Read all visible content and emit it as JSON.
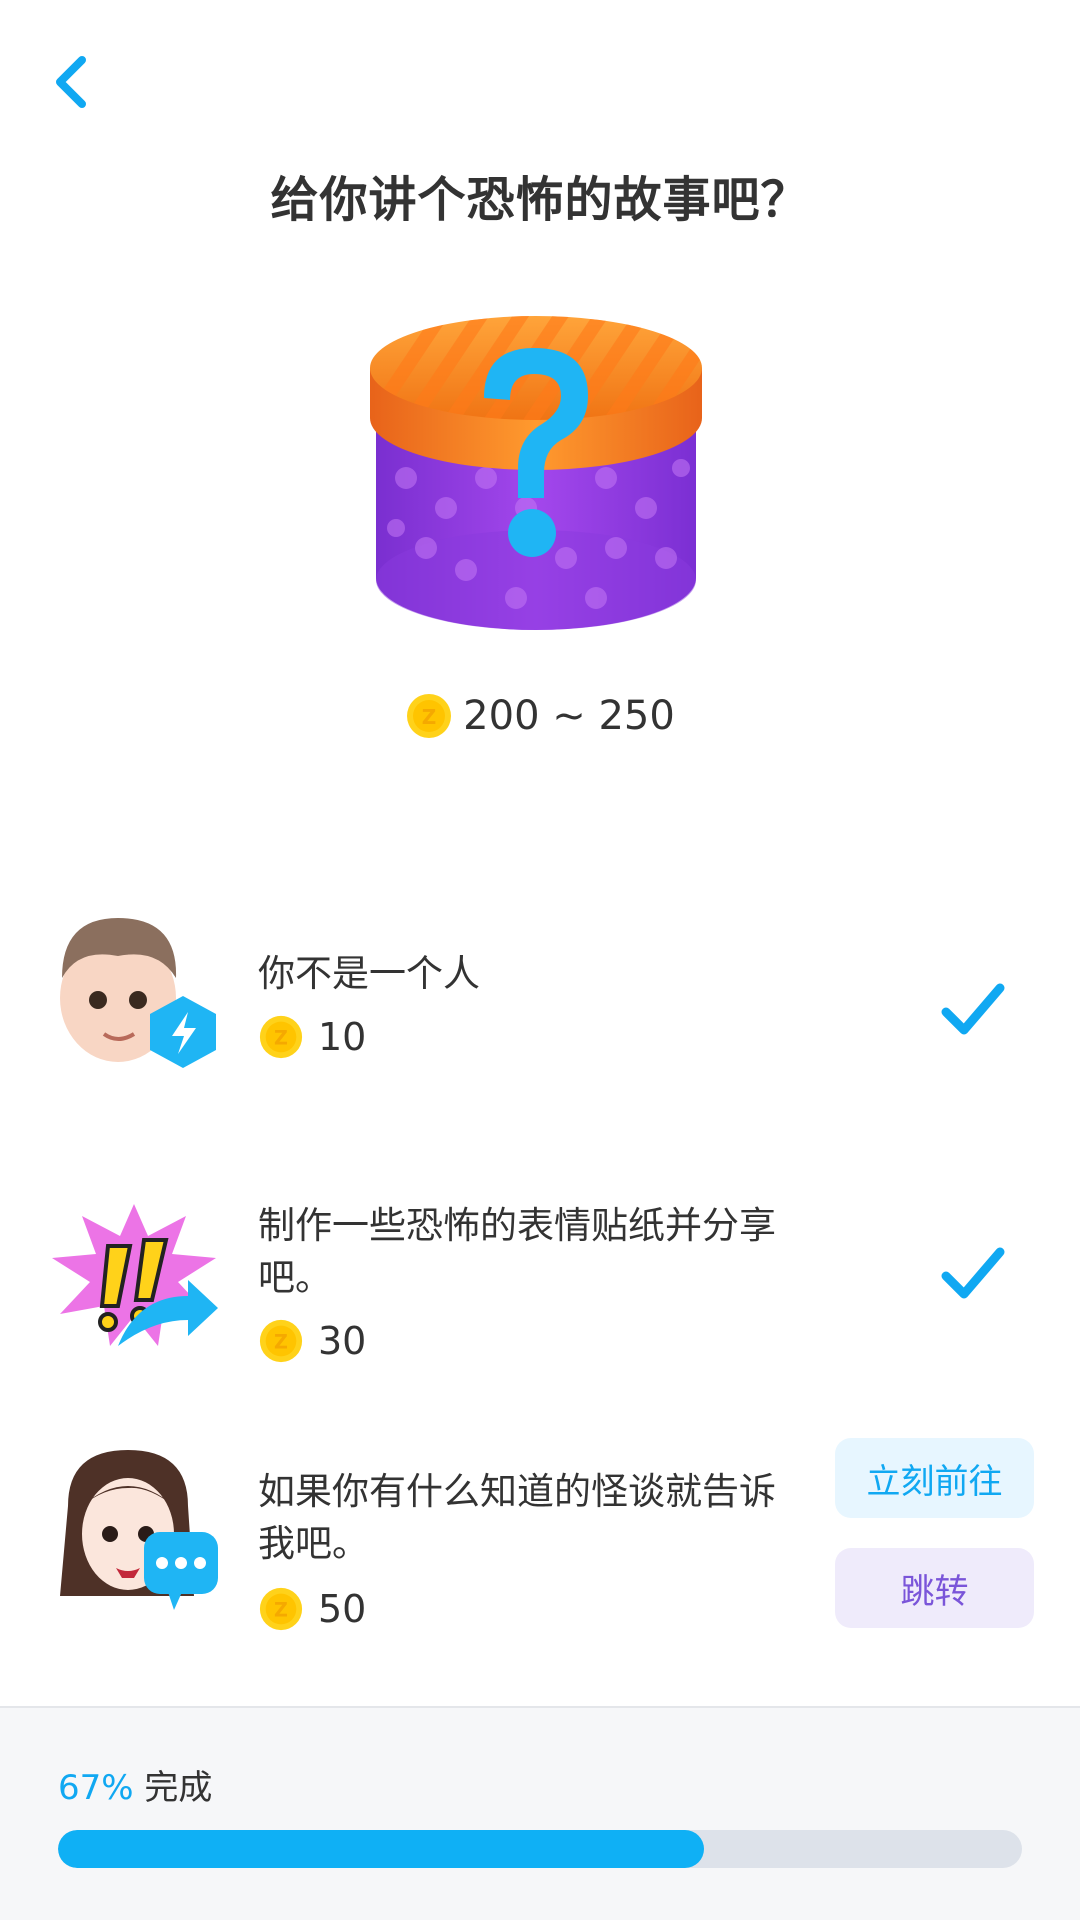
{
  "header": {
    "back_icon": "chevron-left-icon",
    "title": "给你讲个恐怖的故事吧？"
  },
  "mystery_box": {
    "icon": "mystery-gift-box-icon",
    "reward_range": "200 ~ 250"
  },
  "tasks": [
    {
      "avatar": "boy-avatar-lightning-icon",
      "text": "你不是一个人",
      "reward": "10",
      "status": "completed"
    },
    {
      "avatar": "exclamation-share-icon",
      "text": "制作一些恐怖的表情贴纸并分享吧。",
      "reward": "30",
      "status": "completed"
    },
    {
      "avatar": "girl-avatar-chat-icon",
      "text": "如果你有什么知道的怪谈就告诉我吧。",
      "reward": "50",
      "status": "pending",
      "primary_button": "立刻前往",
      "secondary_button": "跳转"
    }
  ],
  "footer": {
    "progress_percent": "67%",
    "progress_suffix": "完成",
    "progress_value": 0.67
  },
  "colors": {
    "accent": "#10a8f2",
    "progress_fill": "#0fb0f5",
    "purple_button_text": "#7a55d9"
  }
}
